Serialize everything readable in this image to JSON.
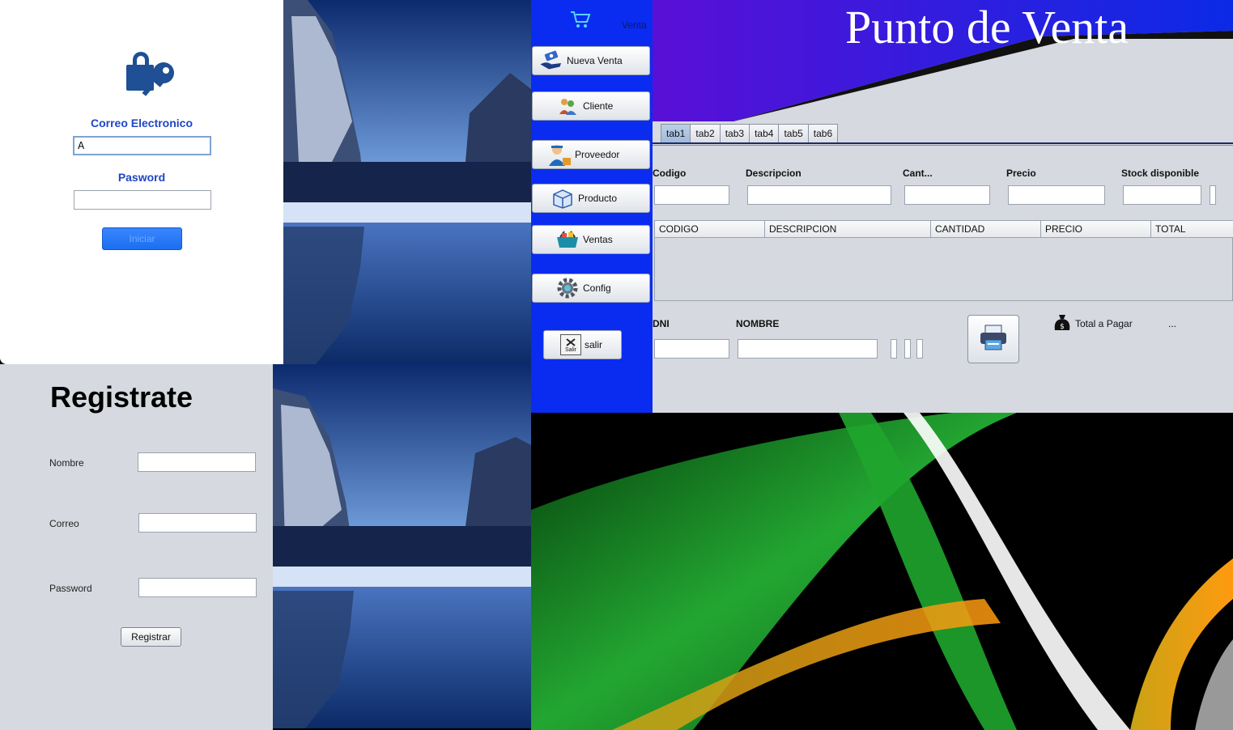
{
  "login": {
    "email_label": "Correo Electronico",
    "email_value": "A",
    "password_label": "Pasword",
    "login_button": "Iniciar"
  },
  "register": {
    "title": "Registrate",
    "name_label": "Nombre",
    "email_label": "Correo",
    "password_label": "Password",
    "register_button": "Registrar"
  },
  "pos": {
    "banner_title": "Punto de Venta",
    "sidebar": {
      "header_label": "Venta",
      "items": [
        {
          "label": "Nueva Venta",
          "icon": "sale-icon"
        },
        {
          "label": "Cliente",
          "icon": "clients-icon"
        },
        {
          "label": "Proveedor",
          "icon": "supplier-icon"
        },
        {
          "label": "Producto",
          "icon": "product-box-icon"
        },
        {
          "label": "Ventas",
          "icon": "basket-icon"
        },
        {
          "label": "Config",
          "icon": "gear-icon"
        }
      ],
      "exit_label": "salir",
      "exit_icon_text": "Salir"
    },
    "tabs": [
      "tab1",
      "tab2",
      "tab3",
      "tab4",
      "tab5",
      "tab6"
    ],
    "fields": {
      "codigo": "Codigo",
      "descripcion": "Descripcion",
      "cantidad": "Cant...",
      "precio": "Precio",
      "stock": "Stock disponible"
    },
    "table_headers": [
      "CODIGO",
      "DESCRIPCION",
      "CANTIDAD",
      "PRECIO",
      "TOTAL"
    ],
    "customer": {
      "dni_label": "DNI",
      "nombre_label": "NOMBRE"
    },
    "total_label": "Total a Pagar",
    "total_value": "..."
  },
  "colors": {
    "sidebar_blue": "#0a2cf0",
    "login_label_blue": "#1f46c4",
    "form_gray": "#d6d9e0"
  }
}
